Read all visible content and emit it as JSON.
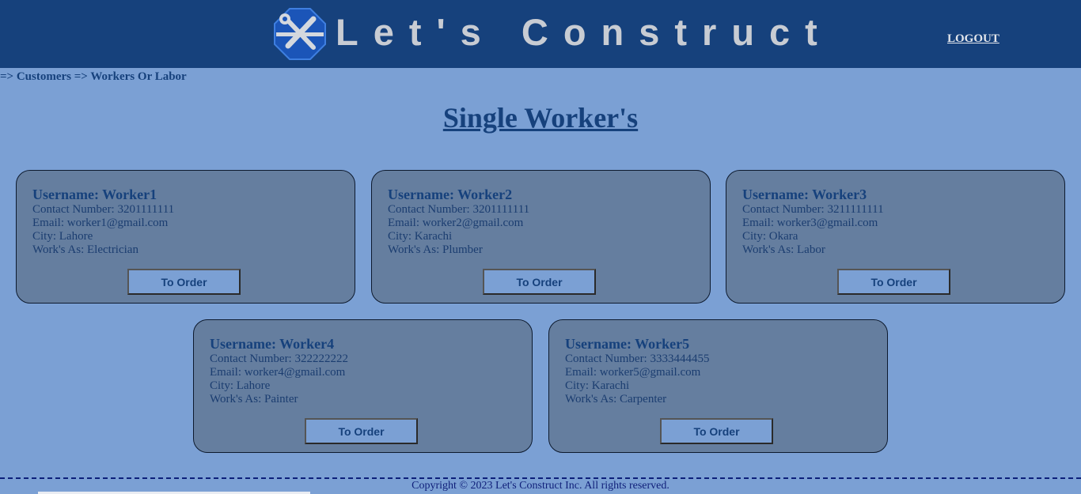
{
  "header": {
    "brand": "Let's Construct",
    "logout_label": "LOGOUT"
  },
  "breadcrumb": "=> Customers => Workers Or Labor",
  "page_title": "Single Worker's",
  "workers": [
    {
      "username": "Username: Worker1",
      "contact": "Contact Number: 3201111111",
      "email": "Email: worker1@gmail.com",
      "city": "City: Lahore",
      "works_as": "Work's As: Electrician",
      "button": "To Order"
    },
    {
      "username": "Username: Worker2",
      "contact": "Contact Number: 3201111111",
      "email": "Email: worker2@gmail.com",
      "city": "City: Karachi",
      "works_as": "Work's As: Plumber",
      "button": "To Order"
    },
    {
      "username": "Username: Worker3",
      "contact": "Contact Number: 3211111111",
      "email": "Email: worker3@gmail.com",
      "city": "City: Okara",
      "works_as": "Work's As: Labor",
      "button": "To Order"
    },
    {
      "username": "Username: Worker4",
      "contact": "Contact Number: 322222222",
      "email": "Email: worker4@gmail.com",
      "city": "City: Lahore",
      "works_as": "Work's As: Painter",
      "button": "To Order"
    },
    {
      "username": "Username: Worker5",
      "contact": "Contact Number: 3333444455",
      "email": "Email: worker5@gmail.com",
      "city": "City: Karachi",
      "works_as": "Work's As: Carpenter",
      "button": "To Order"
    }
  ],
  "footer": "Copyright © 2023 Let's Construct Inc. All rights reserved.",
  "colors": {
    "header_bg": "#16417c",
    "page_bg": "#7ba0d4",
    "card_bg": "#657e9f",
    "accent_text": "#16417c"
  },
  "icons": {
    "logo": "wrench-screwdriver-icon"
  }
}
